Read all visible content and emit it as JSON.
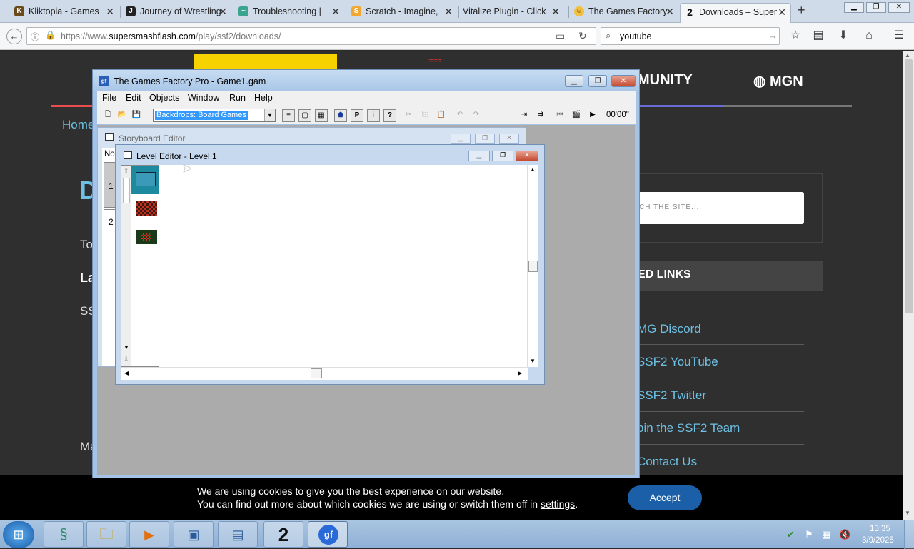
{
  "browser": {
    "tabs": [
      {
        "title": "Kliktopia - Games",
        "icon": "kliktopia-favicon"
      },
      {
        "title": "Journey of Wrestling",
        "icon": "journey-favicon"
      },
      {
        "title": "Troubleshooting |",
        "icon": "troubleshoot-favicon"
      },
      {
        "title": "Scratch - Imagine,",
        "icon": "scratch-favicon"
      },
      {
        "title": "Vitalize Plugin - Click",
        "icon": "blank-favicon"
      },
      {
        "title": "The Games Factory",
        "icon": "smiley-favicon"
      },
      {
        "title": "Downloads – Super",
        "icon": "ssf2-favicon"
      }
    ],
    "new_tab": "+",
    "url_prefix": "https://www.",
    "url_domain": "supersmashflash.com",
    "url_path": "/play/ssf2/downloads/",
    "search_value": "youtube"
  },
  "site": {
    "nav_community": "MUNITY",
    "nav_mgn": "MGN",
    "nav_home": "Home",
    "heading_fragment": "D",
    "text_to": "To",
    "text_la": "La",
    "text_ss": "SS",
    "text_ma": "Ma",
    "search_placeholder": "CH THE SITE...",
    "related_heading": "ED LINKS",
    "links": [
      "MG Discord",
      "SSF2 YouTube",
      "SSF2 Twitter",
      "oin the SSF2 Team",
      "Contact Us"
    ]
  },
  "cookie": {
    "line1": "We are using cookies to give you the best experience on our website.",
    "line2_prefix": "You can find out more about which cookies we are using or switch them off in ",
    "line2_link": "settings",
    "line2_suffix": ".",
    "accept": "Accept"
  },
  "tgf": {
    "title": "The Games Factory Pro - Game1.gam",
    "menu": [
      "File",
      "Edit",
      "Objects",
      "Window",
      "Run",
      "Help"
    ],
    "dropdown_value": "Backdrops: Board Games",
    "time": "00'00\"",
    "storyboard_title": "Storyboard Editor",
    "storyboard_col": "No",
    "storyboard_rows": [
      "1",
      "2"
    ],
    "level_title": "Level Editor - Level 1"
  },
  "taskbar": {
    "time": "13:35",
    "date": "3/9/2025"
  },
  "colors": {
    "accent_blue": "#6ec1e4",
    "accept_button": "#1b5fa8",
    "yellow_bar": "#f6d200"
  }
}
